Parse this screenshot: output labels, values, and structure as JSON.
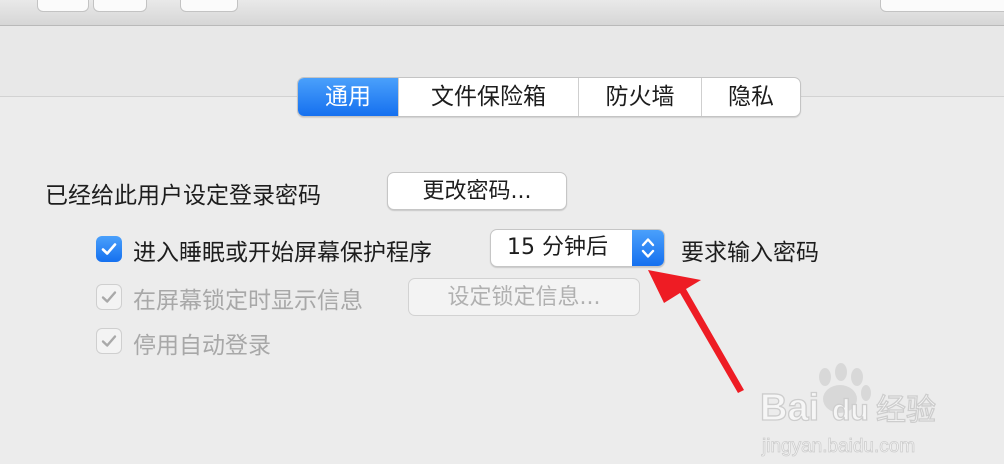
{
  "tabs": [
    {
      "label": "通用",
      "active": true
    },
    {
      "label": "文件保险箱",
      "active": false
    },
    {
      "label": "防火墙",
      "active": false
    },
    {
      "label": "隐私",
      "active": false
    }
  ],
  "general": {
    "password_label": "已经给此用户设定登录密码",
    "change_password_button": "更改密码...",
    "require_password": {
      "checked": true,
      "label": "进入睡眠或开始屏幕保护程序",
      "delay_value": "15 分钟后",
      "suffix": "要求输入密码"
    },
    "lock_message": {
      "checked": true,
      "enabled": false,
      "label": "在屏幕锁定时显示信息",
      "button": "设定锁定信息..."
    },
    "disable_auto_login": {
      "checked": true,
      "enabled": false,
      "label": "停用自动登录"
    }
  },
  "watermark": {
    "brand": "Bai",
    "brand2": "du",
    "suffix": "经验",
    "url": "jingyan.baidu.com"
  },
  "colors": {
    "accent": "#1a75f0",
    "annotation_arrow": "#ee1c24"
  }
}
